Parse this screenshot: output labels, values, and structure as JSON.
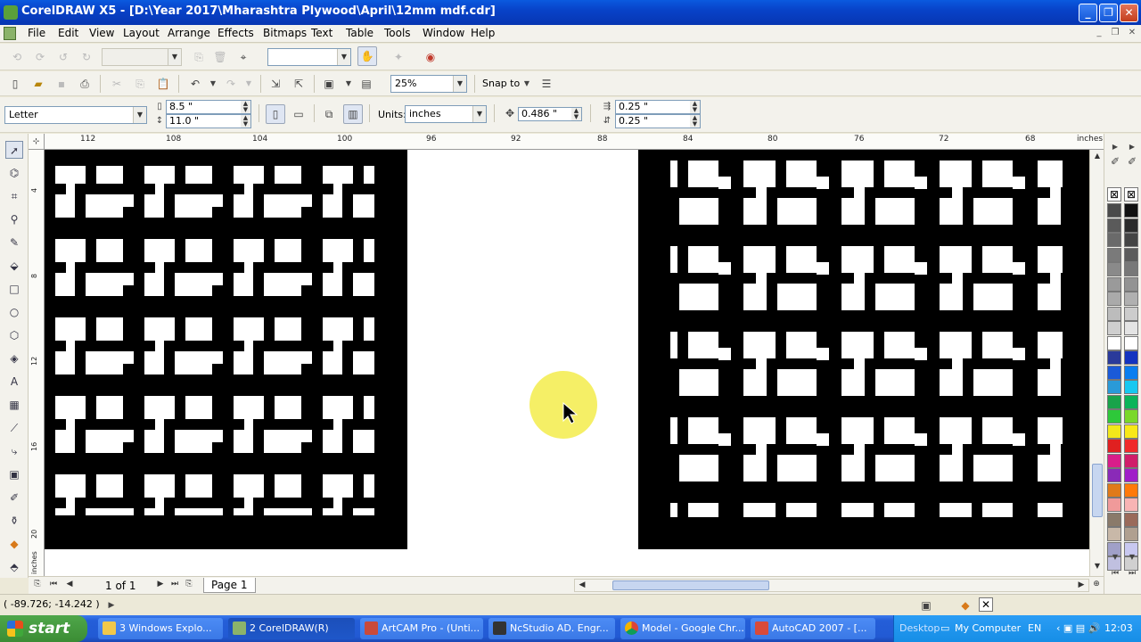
{
  "window": {
    "title": "CorelDRAW X5 - [D:\\Year 2017\\Mharashtra Plywood\\April\\12mm mdf.cdr]"
  },
  "menu": [
    "File",
    "Edit",
    "View",
    "Layout",
    "Arrange",
    "Effects",
    "Bitmaps",
    "Text",
    "Table",
    "Tools",
    "Window",
    "Help"
  ],
  "standard_toolbar": {
    "zoom": "25%",
    "snap_label": "Snap to"
  },
  "property_bar": {
    "paper_size": "Letter",
    "width": "8.5 \"",
    "height": "11.0 \"",
    "units_label": "Units:",
    "units_value": "inches",
    "nudge": "0.486 \"",
    "dup_x": "0.25 \"",
    "dup_y": "0.25 \""
  },
  "ruler": {
    "units": "inches",
    "h_labels": [
      "112",
      "108",
      "104",
      "100",
      "96",
      "92",
      "88",
      "84",
      "80",
      "76",
      "72",
      "68"
    ],
    "v_labels": [
      "4",
      "8",
      "12",
      "16",
      "20"
    ],
    "v_units": "inches"
  },
  "page_nav": {
    "count": "1 of 1",
    "tab": "Page 1"
  },
  "status": {
    "coords": "( -89.726; -14.242 )"
  },
  "taskbar": {
    "start": "start",
    "buttons": [
      "3 Windows Explo...",
      "2 CorelDRAW(R)",
      "ArtCAM Pro - (Unti...",
      "NcStudio AD. Engr...",
      "Model - Google Chr...",
      "AutoCAD 2007 - [..."
    ],
    "desktop": "Desktop",
    "mycomputer": "My Computer",
    "lang": "EN",
    "clock": "12:03"
  },
  "palette_colors": [
    "#4a4a4a",
    "#5a5a5a",
    "#6a6a6a",
    "#7a7a7a",
    "#8a8a8a",
    "#9a9a9a",
    "#aaaaaa",
    "#bcbcbc",
    "#cfcfcf",
    "#ffffff",
    "#2a3a9a",
    "#1a5ad8",
    "#2a9ad8",
    "#19a34a",
    "#2ec83a",
    "#f2e81a",
    "#e02020",
    "#d81e8a",
    "#8a2ab8",
    "#e07a1a",
    "#f09a9a",
    "#8a7a6a",
    "#c8b8a8",
    "#a0a0c8",
    "#c0c0e0"
  ],
  "palette_colors_right": [
    "#111111",
    "#2b2b2b",
    "#444444",
    "#5c5c5c",
    "#787878",
    "#939393",
    "#b0b0b0",
    "#cccccc",
    "#e4e4e4",
    "#ffffff",
    "#1433c0",
    "#0a7ef0",
    "#18c8f0",
    "#0cb45a",
    "#7ad82a",
    "#f8e818",
    "#f02a2a",
    "#d01e6a",
    "#a01ec8",
    "#ff7a0a",
    "#f8b4b4",
    "#9a6a5a",
    "#b0a090",
    "#c8c8f0",
    "#d0d0d0"
  ]
}
